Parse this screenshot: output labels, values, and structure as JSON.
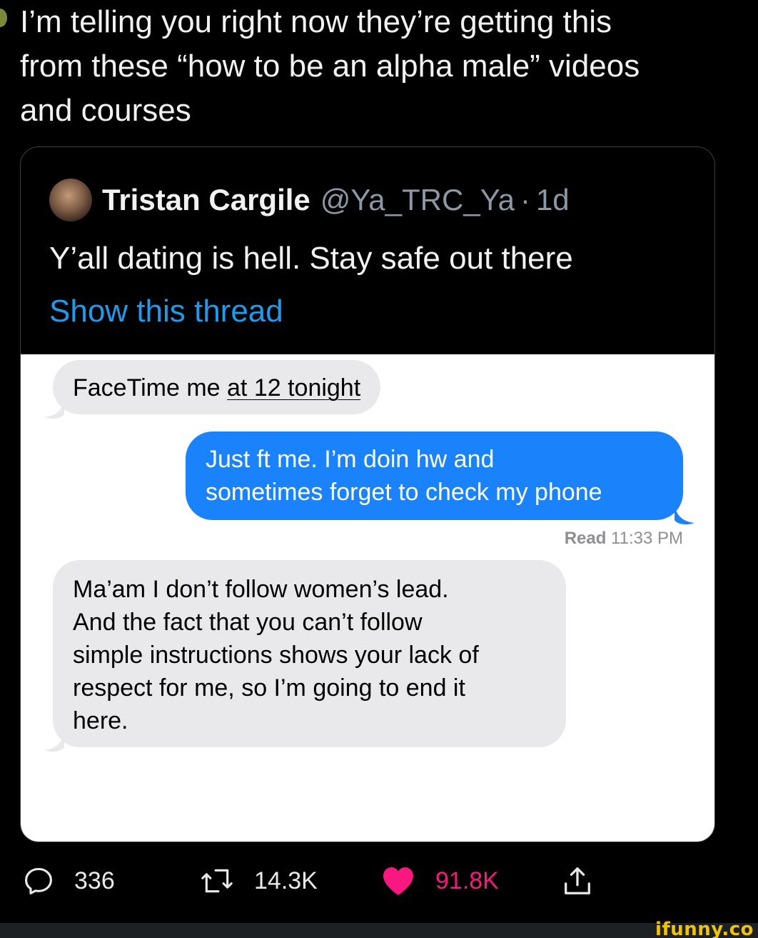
{
  "tweet": {
    "text": "I’m telling you right now they’re getting this\nfrom these “how to be an alpha male” videos\nand courses"
  },
  "quoted_tweet": {
    "name": "Tristan Cargile",
    "handle": "@Ya_TRC_Ya",
    "separator": "·",
    "age": "1d",
    "text": "Y’all dating is hell. Stay safe out there",
    "show_thread": "Show this thread"
  },
  "chat": {
    "message_1_prefix": "FaceTime me ",
    "message_1_link": "at 12 tonight",
    "message_2": "Just ft me. I’m doin hw and\nsometimes forget to check my phone",
    "read_label": "Read",
    "read_time": "11:33 PM",
    "message_3": "Ma’am I don’t follow women’s lead.\nAnd the fact that you can’t follow\nsimple instructions shows your lack of\nrespect for me, so I’m going to end it\nhere."
  },
  "actions": {
    "replies": "336",
    "retweets": "14.3K",
    "likes": "91.8K"
  },
  "colors": {
    "link_blue": "#1d9bf0",
    "imessage_blue": "#1a82fb",
    "like_pink": "#f91880",
    "watermark_yellow": "#f2c300"
  },
  "watermark": "ifunny.co"
}
